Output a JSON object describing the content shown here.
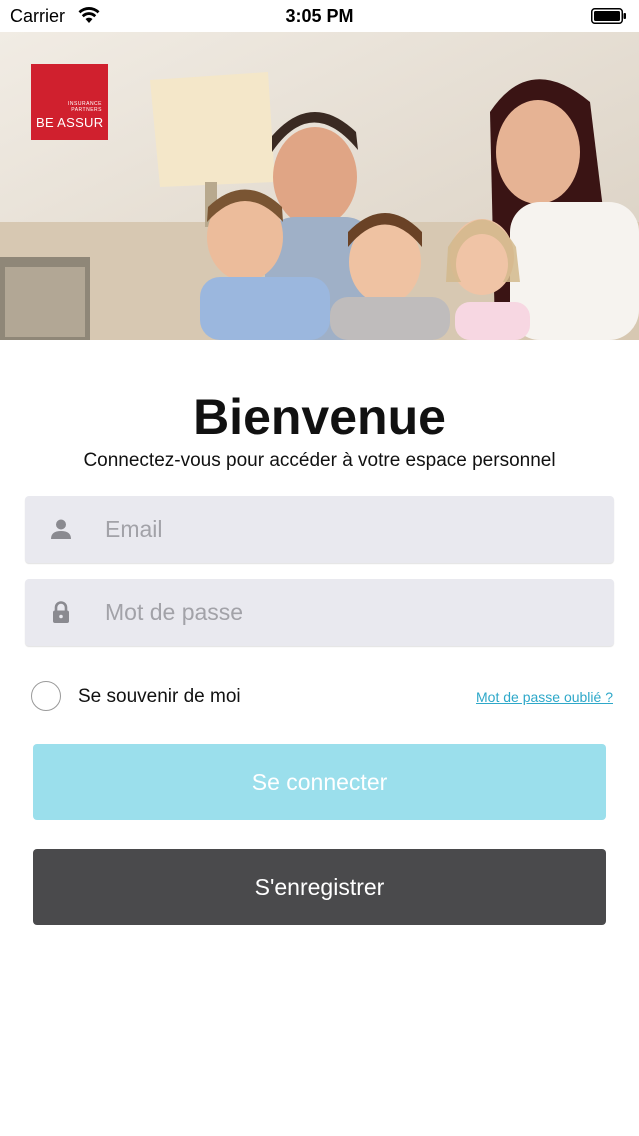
{
  "status_bar": {
    "carrier": "Carrier",
    "time": "3:05 PM",
    "icons": [
      "wifi-icon",
      "battery-icon"
    ]
  },
  "brand": {
    "tagline_line1": "INSURANCE",
    "tagline_line2": "PARTNERS",
    "name": "BE ASSUR",
    "color": "#d0202e"
  },
  "login": {
    "title": "Bienvenue",
    "subtitle": "Connectez-vous pour accéder à votre espace personnel",
    "email_placeholder": "Email",
    "password_placeholder": "Mot de passe",
    "remember_label": "Se souvenir de moi",
    "forgot_label": "Mot de passe oublié ?",
    "login_label": "Se connecter",
    "register_label": "S'enregistrer"
  },
  "colors": {
    "login_button": "#9bdfec",
    "register_button": "#4a4a4c",
    "link": "#2ea8c9",
    "field_bg": "#e9e9ef"
  }
}
